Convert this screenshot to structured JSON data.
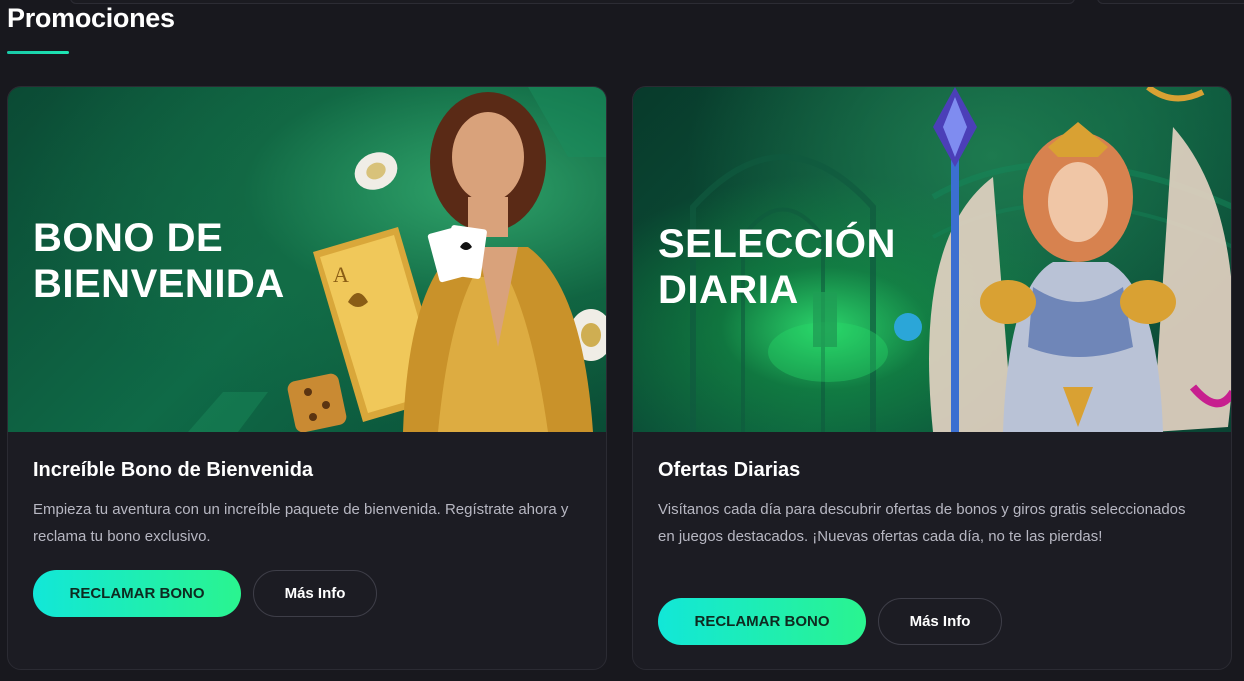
{
  "page": {
    "title": "Promociones",
    "accent": "#1ee6b4",
    "background": "#18181e"
  },
  "promotions": [
    {
      "banner_text": "BONO DE BIENVENIDA",
      "title": "Increíble Bono de Bienvenida",
      "description": "Empieza tu aventura con un increíble paquete de bienvenida. Regístrate ahora y reclama tu bono exclusivo.",
      "claim_label": "RECLAMAR BONO",
      "info_label": "Más Info",
      "banner_theme": "green",
      "illustration": "woman-gold-dress-playing-cards-chips-dice"
    },
    {
      "banner_text": "SELECCIÓN DIARIA",
      "title": "Ofertas Diarias",
      "description": "Visítanos cada día para descubrir ofertas de bonos y giros gratis seleccionados en juegos destacados. ¡Nuevas ofertas cada día, no te las pierdas!",
      "claim_label": "RECLAMAR BONO",
      "info_label": "Más Info",
      "banner_theme": "dark-green",
      "illustration": "winged-warrior-with-staff"
    }
  ],
  "colors": {
    "claim_gradient_start": "#12e7d8",
    "claim_gradient_end": "#2af48f",
    "card_bg": "#1c1c23",
    "description_text": "#b7b7c2"
  }
}
